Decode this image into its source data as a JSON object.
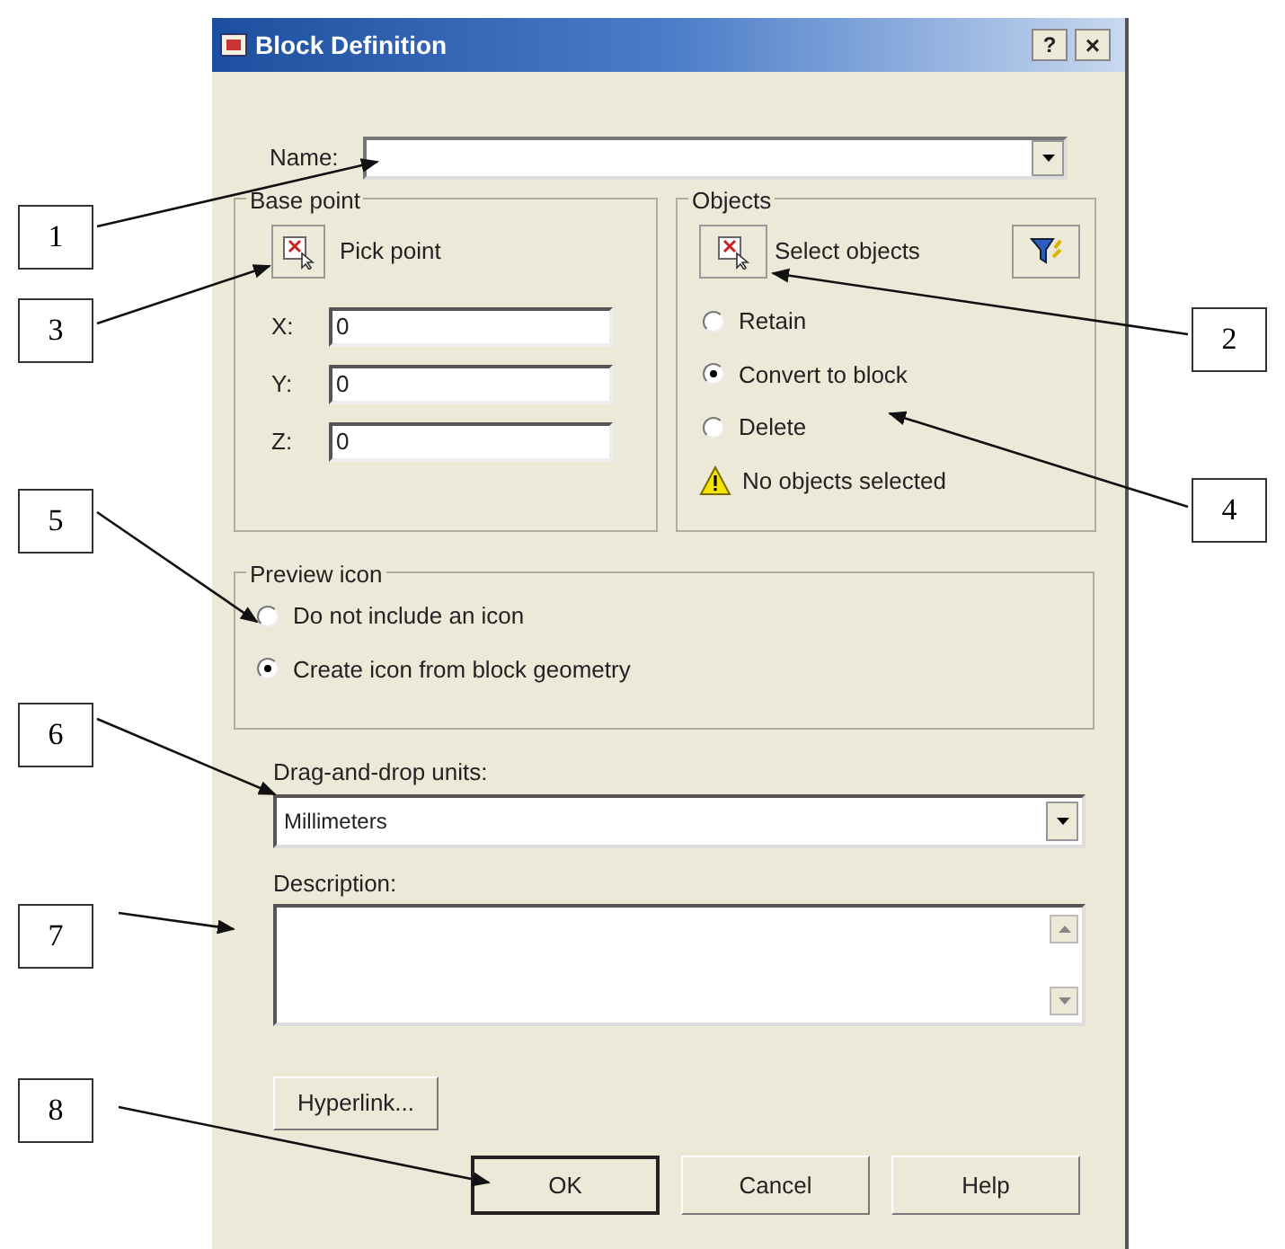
{
  "window": {
    "title": "Block Definition",
    "help_button": "?",
    "close_button": "×"
  },
  "name_field": {
    "label": "Name:"
  },
  "base_point": {
    "title": "Base point",
    "pick_button": "Pick point",
    "coords": [
      {
        "label": "X:",
        "value": "0"
      },
      {
        "label": "Y:",
        "value": "0"
      },
      {
        "label": "Z:",
        "value": "0"
      }
    ]
  },
  "objects": {
    "title": "Objects",
    "select_button": "Select objects",
    "options": [
      {
        "label": "Retain",
        "selected": false
      },
      {
        "label": "Convert to block",
        "selected": true
      },
      {
        "label": "Delete",
        "selected": false
      }
    ],
    "warning": "No objects selected"
  },
  "preview_icon": {
    "title": "Preview icon",
    "options": [
      {
        "label": "Do not include an icon",
        "selected": false
      },
      {
        "label": "Create icon from block geometry",
        "selected": true
      }
    ]
  },
  "units": {
    "label": "Drag-and-drop units:",
    "value": "Millimeters"
  },
  "description": {
    "label": "Description:"
  },
  "hyperlink_button": "Hyperlink...",
  "buttons": [
    {
      "label": "OK",
      "default": true
    },
    {
      "label": "Cancel",
      "default": false
    },
    {
      "label": "Help",
      "default": false
    }
  ],
  "callouts": [
    {
      "number": "1"
    },
    {
      "number": "3"
    },
    {
      "number": "5"
    },
    {
      "number": "6"
    },
    {
      "number": "7"
    },
    {
      "number": "8"
    },
    {
      "number": "2"
    },
    {
      "number": "4"
    }
  ]
}
